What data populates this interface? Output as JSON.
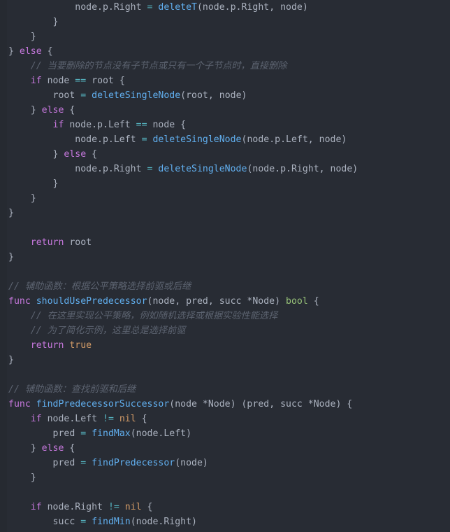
{
  "editor": {
    "language": "go",
    "theme": "One Dark",
    "background": "#282c34",
    "gutter_background": "#262a31",
    "colors": {
      "plain": "#abb2bf",
      "keyword": "#c678dd",
      "function": "#61afef",
      "operator": "#56b6c2",
      "constant": "#d19a66",
      "type": "#98c379",
      "comment": "#5c6370"
    }
  },
  "code": {
    "lines": [
      [
        {
          "text": "            node.p.Right ",
          "k": "plain"
        },
        {
          "text": "=",
          "k": "op"
        },
        {
          "text": " ",
          "k": "plain"
        },
        {
          "text": "deleteT",
          "k": "func"
        },
        {
          "text": "(node.p.Right, node)",
          "k": "plain"
        }
      ],
      [
        {
          "text": "        }",
          "k": "plain"
        }
      ],
      [
        {
          "text": "    }",
          "k": "plain"
        }
      ],
      [
        {
          "text": "} ",
          "k": "plain"
        },
        {
          "text": "else",
          "k": "keyword"
        },
        {
          "text": " {",
          "k": "plain"
        }
      ],
      [
        {
          "text": "    // 当要删除的节点没有子节点或只有一个子节点时，直接删除",
          "k": "comment"
        }
      ],
      [
        {
          "text": "    ",
          "k": "plain"
        },
        {
          "text": "if",
          "k": "keyword"
        },
        {
          "text": " node ",
          "k": "plain"
        },
        {
          "text": "==",
          "k": "op"
        },
        {
          "text": " root {",
          "k": "plain"
        }
      ],
      [
        {
          "text": "        root ",
          "k": "plain"
        },
        {
          "text": "=",
          "k": "op"
        },
        {
          "text": " ",
          "k": "plain"
        },
        {
          "text": "deleteSingleNode",
          "k": "func"
        },
        {
          "text": "(root, node)",
          "k": "plain"
        }
      ],
      [
        {
          "text": "    } ",
          "k": "plain"
        },
        {
          "text": "else",
          "k": "keyword"
        },
        {
          "text": " {",
          "k": "plain"
        }
      ],
      [
        {
          "text": "        ",
          "k": "plain"
        },
        {
          "text": "if",
          "k": "keyword"
        },
        {
          "text": " node.p.Left ",
          "k": "plain"
        },
        {
          "text": "==",
          "k": "op"
        },
        {
          "text": " node {",
          "k": "plain"
        }
      ],
      [
        {
          "text": "            node.p.Left ",
          "k": "plain"
        },
        {
          "text": "=",
          "k": "op"
        },
        {
          "text": " ",
          "k": "plain"
        },
        {
          "text": "deleteSingleNode",
          "k": "func"
        },
        {
          "text": "(node.p.Left, node)",
          "k": "plain"
        }
      ],
      [
        {
          "text": "        } ",
          "k": "plain"
        },
        {
          "text": "else",
          "k": "keyword"
        },
        {
          "text": " {",
          "k": "plain"
        }
      ],
      [
        {
          "text": "            node.p.Right ",
          "k": "plain"
        },
        {
          "text": "=",
          "k": "op"
        },
        {
          "text": " ",
          "k": "plain"
        },
        {
          "text": "deleteSingleNode",
          "k": "func"
        },
        {
          "text": "(node.p.Right, node)",
          "k": "plain"
        }
      ],
      [
        {
          "text": "        }",
          "k": "plain"
        }
      ],
      [
        {
          "text": "    }",
          "k": "plain"
        }
      ],
      [
        {
          "text": "}",
          "k": "plain"
        }
      ],
      [
        {
          "text": "",
          "k": "plain"
        }
      ],
      [
        {
          "text": "    ",
          "k": "plain"
        },
        {
          "text": "return",
          "k": "keyword"
        },
        {
          "text": " root",
          "k": "plain"
        }
      ],
      [
        {
          "text": "}",
          "k": "plain"
        }
      ],
      [
        {
          "text": "",
          "k": "plain"
        }
      ],
      [
        {
          "text": "// 辅助函数：根据公平策略选择前驱或后继",
          "k": "comment"
        }
      ],
      [
        {
          "text": "func",
          "k": "keyword"
        },
        {
          "text": " ",
          "k": "plain"
        },
        {
          "text": "shouldUsePredecessor",
          "k": "func"
        },
        {
          "text": "(node, pred, succ *Node) ",
          "k": "plain"
        },
        {
          "text": "bool",
          "k": "type"
        },
        {
          "text": " {",
          "k": "plain"
        }
      ],
      [
        {
          "text": "    // 在这里实现公平策略，例如随机选择或根据实验性能选择",
          "k": "comment"
        }
      ],
      [
        {
          "text": "    // 为了简化示例，这里总是选择前驱",
          "k": "comment"
        }
      ],
      [
        {
          "text": "    ",
          "k": "plain"
        },
        {
          "text": "return",
          "k": "keyword"
        },
        {
          "text": " ",
          "k": "plain"
        },
        {
          "text": "true",
          "k": "const"
        }
      ],
      [
        {
          "text": "}",
          "k": "plain"
        }
      ],
      [
        {
          "text": "",
          "k": "plain"
        }
      ],
      [
        {
          "text": "// 辅助函数：查找前驱和后继",
          "k": "comment"
        }
      ],
      [
        {
          "text": "func",
          "k": "keyword"
        },
        {
          "text": " ",
          "k": "plain"
        },
        {
          "text": "findPredecessorSuccessor",
          "k": "func"
        },
        {
          "text": "(node *Node) (pred, succ *Node) {",
          "k": "plain"
        }
      ],
      [
        {
          "text": "    ",
          "k": "plain"
        },
        {
          "text": "if",
          "k": "keyword"
        },
        {
          "text": " node.Left ",
          "k": "plain"
        },
        {
          "text": "!=",
          "k": "op"
        },
        {
          "text": " ",
          "k": "plain"
        },
        {
          "text": "nil",
          "k": "const"
        },
        {
          "text": " {",
          "k": "plain"
        }
      ],
      [
        {
          "text": "        pred ",
          "k": "plain"
        },
        {
          "text": "=",
          "k": "op"
        },
        {
          "text": " ",
          "k": "plain"
        },
        {
          "text": "findMax",
          "k": "func"
        },
        {
          "text": "(node.Left)",
          "k": "plain"
        }
      ],
      [
        {
          "text": "    } ",
          "k": "plain"
        },
        {
          "text": "else",
          "k": "keyword"
        },
        {
          "text": " {",
          "k": "plain"
        }
      ],
      [
        {
          "text": "        pred ",
          "k": "plain"
        },
        {
          "text": "=",
          "k": "op"
        },
        {
          "text": " ",
          "k": "plain"
        },
        {
          "text": "findPredecessor",
          "k": "func"
        },
        {
          "text": "(node)",
          "k": "plain"
        }
      ],
      [
        {
          "text": "    }",
          "k": "plain"
        }
      ],
      [
        {
          "text": "",
          "k": "plain"
        }
      ],
      [
        {
          "text": "    ",
          "k": "plain"
        },
        {
          "text": "if",
          "k": "keyword"
        },
        {
          "text": " node.Right ",
          "k": "plain"
        },
        {
          "text": "!=",
          "k": "op"
        },
        {
          "text": " ",
          "k": "plain"
        },
        {
          "text": "nil",
          "k": "const"
        },
        {
          "text": " {",
          "k": "plain"
        }
      ],
      [
        {
          "text": "        succ ",
          "k": "plain"
        },
        {
          "text": "=",
          "k": "op"
        },
        {
          "text": " ",
          "k": "plain"
        },
        {
          "text": "findMin",
          "k": "func"
        },
        {
          "text": "(node.Right)",
          "k": "plain"
        }
      ]
    ]
  }
}
